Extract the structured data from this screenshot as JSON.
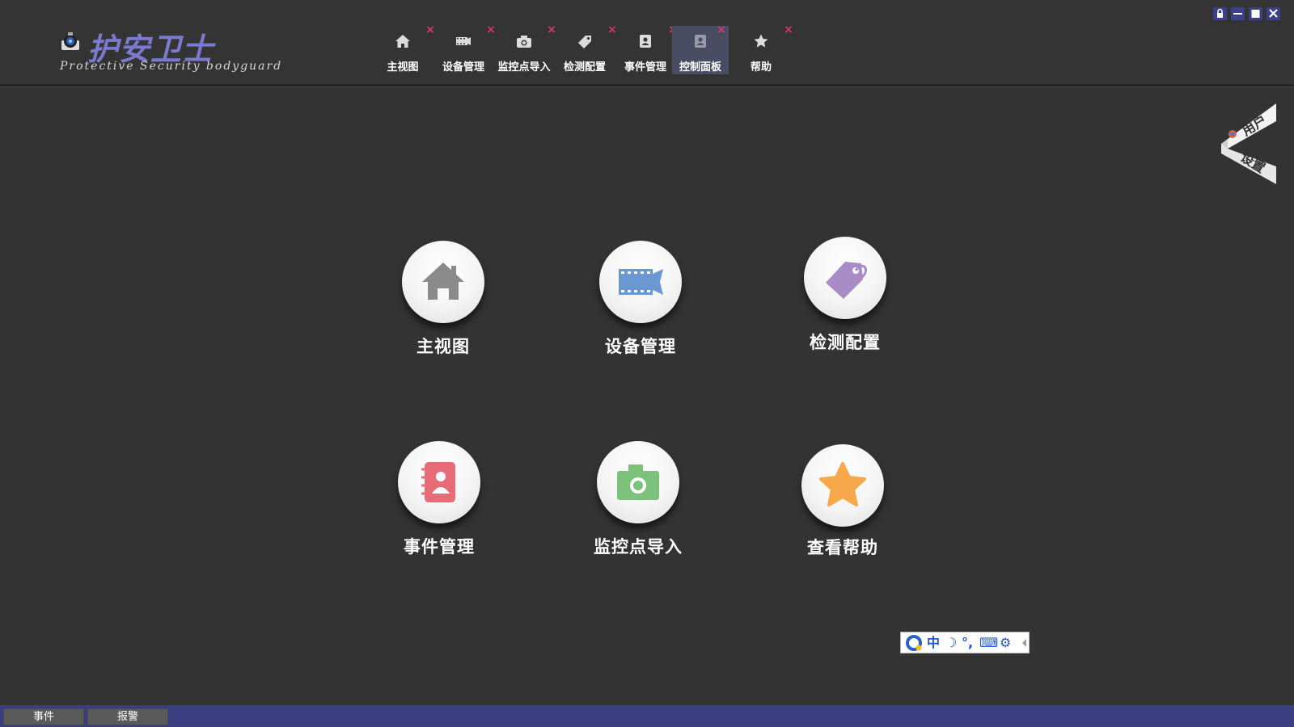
{
  "logo": {
    "title": "护安卫士",
    "subtitle": "Protective Security bodyguard"
  },
  "tabs": [
    {
      "label": "主视图",
      "icon": "home-icon",
      "close": "×",
      "active": false
    },
    {
      "label": "设备管理",
      "icon": "film-camera-icon",
      "close": "×",
      "active": false
    },
    {
      "label": "监控点导入",
      "icon": "camera-icon",
      "close": "×",
      "active": false
    },
    {
      "label": "检测配置",
      "icon": "tag-icon",
      "close": "×",
      "active": false
    },
    {
      "label": "事件管理",
      "icon": "contact-book-icon",
      "close": "×",
      "active": false
    },
    {
      "label": "控制面板",
      "icon": "contact-book-icon",
      "close": "×",
      "active": true
    },
    {
      "label": "帮助",
      "icon": "star-icon",
      "close": "×",
      "active": false
    }
  ],
  "window_controls": [
    "lock-icon",
    "minimize-icon",
    "maximize-icon",
    "close-icon"
  ],
  "ribbon": {
    "top": "用户",
    "bottom": "设置"
  },
  "tiles": [
    {
      "label": "主视图",
      "icon": "home-icon",
      "color": "#8a8a8a"
    },
    {
      "label": "设备管理",
      "icon": "film-camera-icon",
      "color": "#6c98d2"
    },
    {
      "label": "检测配置",
      "icon": "tag-icon",
      "color": "#a98bc6"
    },
    {
      "label": "事件管理",
      "icon": "contact-book-icon",
      "color": "#e86b78"
    },
    {
      "label": "监控点导入",
      "icon": "camera-icon",
      "color": "#7cc27a"
    },
    {
      "label": "查看帮助",
      "icon": "star-icon",
      "color": "#f6a84a"
    }
  ],
  "ime": {
    "items": [
      "中",
      "☽",
      "°,",
      "⌨",
      "⚙"
    ]
  },
  "statusbar": {
    "buttons": [
      "事件",
      "报警"
    ]
  },
  "colors": {
    "background": "#333333",
    "active_tab": "#494d63",
    "statusbar": "#3a3e80",
    "close_mark": "#e0356a",
    "logo_text": "#7a7ad0"
  }
}
